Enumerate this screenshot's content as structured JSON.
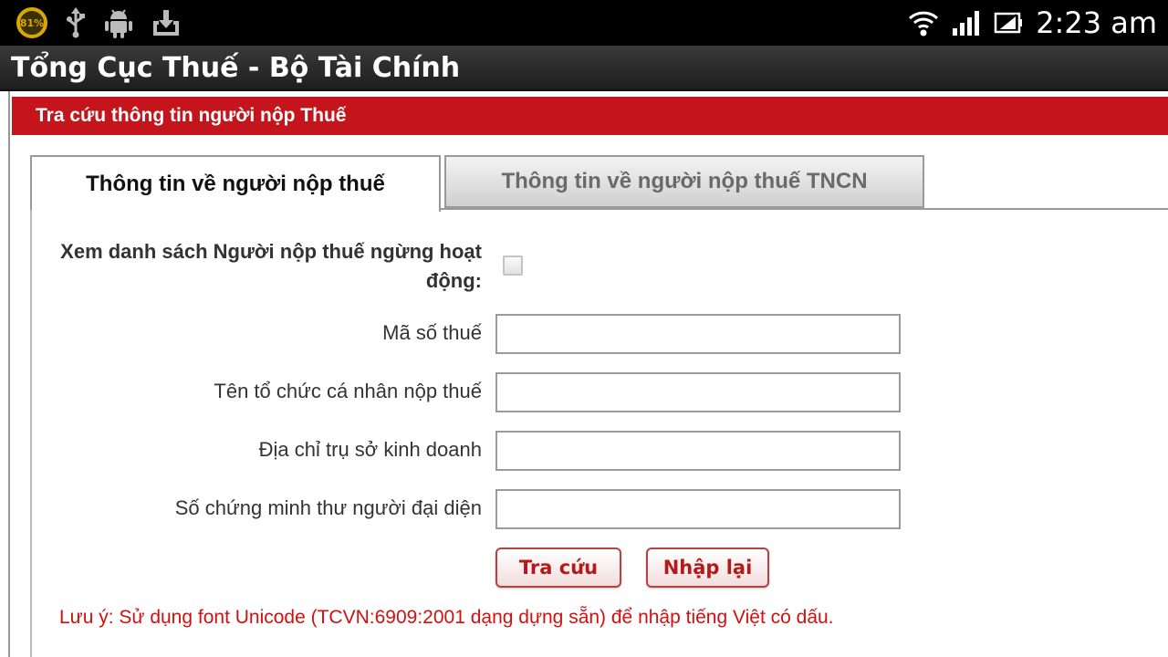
{
  "status_bar": {
    "battery_percent": "81%",
    "time": "2:23 am",
    "icons": [
      "battery-circle-icon",
      "usb-icon",
      "android-debug-icon",
      "download-icon",
      "wifi-icon",
      "signal-icon",
      "battery-charging-icon"
    ]
  },
  "app": {
    "title": "Tổng Cục Thuế - Bộ Tài Chính"
  },
  "section": {
    "title": "Tra cứu thông tin người nộp Thuế"
  },
  "tabs": [
    {
      "label": "Thông tin về người nộp thuế",
      "active": true
    },
    {
      "label": "Thông tin về người nộp thuế TNCN",
      "active": false
    }
  ],
  "form": {
    "inactive_label_line1": "Xem danh sách Người nộp thuế ngừng hoạt",
    "inactive_label_line2": "động:",
    "inactive_checked": false,
    "fields": [
      {
        "label": "Mã số thuế",
        "value": ""
      },
      {
        "label": "Tên tổ chức cá nhân nộp thuế",
        "value": ""
      },
      {
        "label": "Địa chỉ trụ sở kinh doanh",
        "value": ""
      },
      {
        "label": "Số chứng minh thư người đại diện",
        "value": ""
      }
    ],
    "search_button": "Tra cứu",
    "reset_button": "Nhập lại",
    "note": "Lưu ý: Sử dụng font Unicode (TCVN:6909:2001 dạng dựng sẵn) để nhập tiếng Việt có dấu."
  },
  "colors": {
    "header_red": "#c4141c",
    "note_red": "#d21010",
    "battery_yellow": "#d9a800"
  }
}
